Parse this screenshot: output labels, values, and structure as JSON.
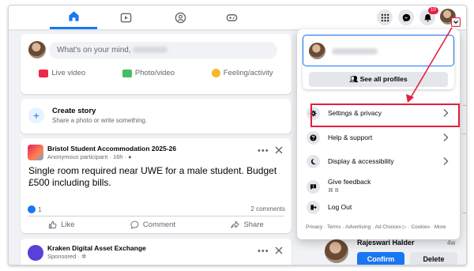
{
  "app": {
    "accent": "#1877f2",
    "highlight": "#e41e3f"
  },
  "nav": {
    "tabs": [
      {
        "icon": "home-icon",
        "active": true
      },
      {
        "icon": "video-icon",
        "active": false
      },
      {
        "icon": "groups-icon",
        "active": false
      },
      {
        "icon": "gaming-icon",
        "active": false
      }
    ],
    "right_icons": [
      "menu-grid-icon",
      "messenger-icon",
      "notifications-icon"
    ],
    "notification_badge": "10"
  },
  "composer": {
    "placeholder": "What's on your mind,",
    "actions": [
      {
        "icon": "live-video-icon",
        "label": "Live video",
        "color": "#f02849"
      },
      {
        "icon": "photo-video-icon",
        "label": "Photo/video",
        "color": "#45bd62"
      },
      {
        "icon": "feeling-icon",
        "label": "Feeling/activity",
        "color": "#f7b928"
      }
    ]
  },
  "story": {
    "title": "Create story",
    "subtitle": "Share a photo or write something."
  },
  "post": {
    "group": "Bristol Student Accommodation 2025-26",
    "author": "Anonymous participant · 16h ·",
    "text": "Single room required near UWE for a male student. Budget £500 including bills.",
    "likes": "1",
    "comments": "2 comments",
    "actions": [
      "Like",
      "Comment",
      "Share"
    ]
  },
  "sponsored": {
    "name": "Kraken Digital Asset Exchange",
    "meta": "Sponsored ·"
  },
  "friend_request": {
    "name": "Rajeswari Halder",
    "time": "4w",
    "confirm": "Confirm",
    "delete": "Delete"
  },
  "account_menu": {
    "see_all": "See all profiles",
    "items": [
      {
        "label": "Settings & privacy",
        "icon": "settings-gear-icon",
        "chevron": true
      },
      {
        "label": "Help & support",
        "icon": "help-icon",
        "chevron": true
      },
      {
        "label": "Display & accessibility",
        "icon": "moon-icon",
        "chevron": true
      },
      {
        "label": "Give feedback",
        "sub": "⌘ B",
        "icon": "feedback-icon",
        "chevron": false
      },
      {
        "label": "Log Out",
        "icon": "logout-icon",
        "chevron": false
      }
    ],
    "footer": "Privacy · Terms · Advertising · Ad Choices ▷ · Cookies · More"
  }
}
